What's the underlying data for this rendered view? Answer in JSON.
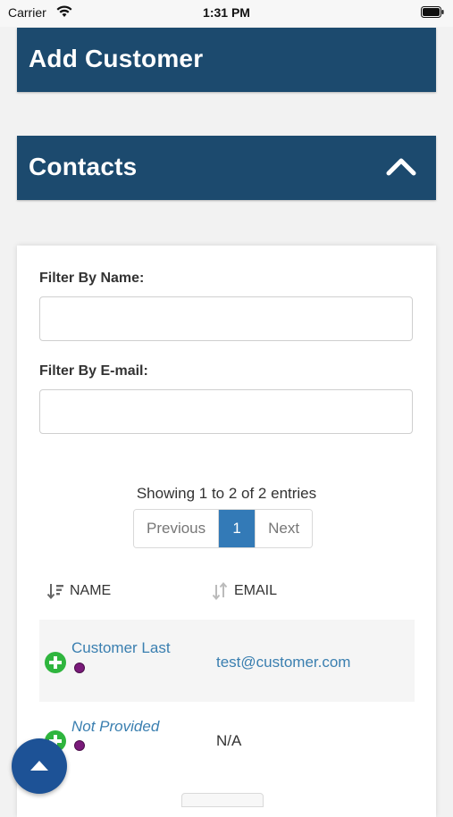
{
  "status_bar": {
    "carrier": "Carrier",
    "time": "1:31 PM"
  },
  "panels": {
    "add_customer": {
      "title": "Add Customer"
    },
    "contacts": {
      "title": "Contacts"
    }
  },
  "filters": {
    "name_label": "Filter By Name:",
    "name_value": "",
    "email_label": "Filter By E-mail:",
    "email_value": ""
  },
  "table_info": "Showing 1 to 2 of 2 entries",
  "pagination": {
    "previous": "Previous",
    "current": "1",
    "next": "Next"
  },
  "table": {
    "columns": [
      "NAME",
      "EMAIL"
    ],
    "rows": [
      {
        "name": "Customer Last",
        "email": "test@customer.com"
      },
      {
        "name": "Not Provided",
        "email": "N/A"
      }
    ]
  },
  "colors": {
    "header_bg": "#1c4a6e",
    "link": "#3a7fb0",
    "active_page": "#337ab7",
    "plus_green": "#2fb53e",
    "dot_purple": "#7a1a7a"
  }
}
